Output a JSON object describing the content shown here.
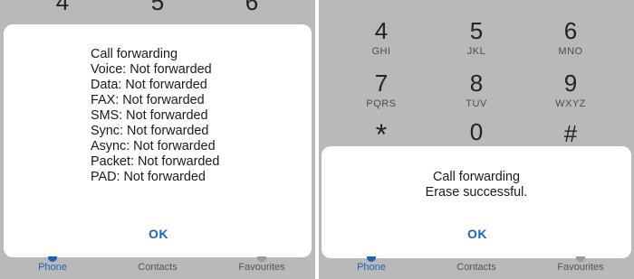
{
  "left": {
    "keys_partial": [
      {
        "digit": "4"
      },
      {
        "digit": "5"
      },
      {
        "digit": "6"
      }
    ],
    "dialog": {
      "title": "Call forwarding",
      "lines": [
        "Voice: Not forwarded",
        "Data: Not forwarded",
        "FAX: Not forwarded",
        "SMS: Not forwarded",
        "Sync: Not forwarded",
        "Async: Not forwarded",
        "Packet: Not forwarded",
        "PAD: Not forwarded"
      ],
      "ok_label": "OK"
    },
    "nav": [
      {
        "label": "Phone",
        "active": true
      },
      {
        "label": "Contacts",
        "active": false
      },
      {
        "label": "Favourites",
        "active": false
      }
    ]
  },
  "right": {
    "keys": [
      {
        "digit": "4",
        "letters": "GHI"
      },
      {
        "digit": "5",
        "letters": "JKL"
      },
      {
        "digit": "6",
        "letters": "MNO"
      },
      {
        "digit": "7",
        "letters": "PQRS"
      },
      {
        "digit": "8",
        "letters": "TUV"
      },
      {
        "digit": "9",
        "letters": "WXYZ"
      },
      {
        "digit": "*",
        "letters": ""
      },
      {
        "digit": "0",
        "letters": "+"
      },
      {
        "digit": "#",
        "letters": ""
      }
    ],
    "dialog": {
      "title": "Call forwarding",
      "message": "Erase successful.",
      "ok_label": "OK"
    },
    "nav": [
      {
        "label": "Phone",
        "active": true
      },
      {
        "label": "Contacts",
        "active": false
      },
      {
        "label": "Favourites",
        "active": false
      }
    ]
  },
  "colors": {
    "accent": "#1565c0",
    "dim_background": "#b9b9b9",
    "dialog_background": "#ffffff"
  }
}
